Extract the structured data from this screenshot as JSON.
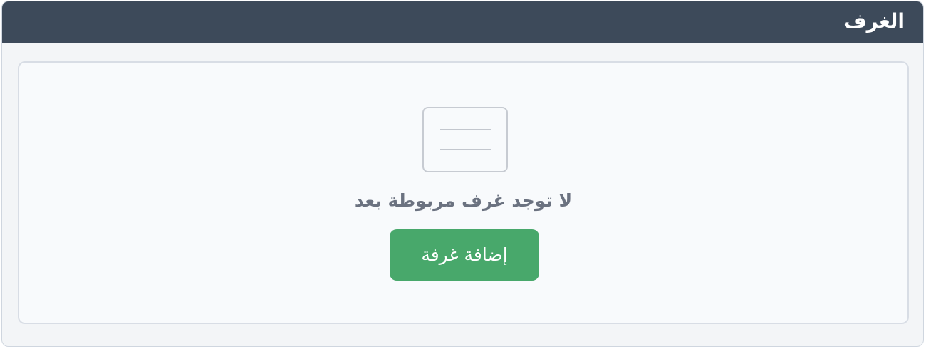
{
  "header": {
    "title": "الغرف"
  },
  "empty_state": {
    "icon": "empty-list-icon",
    "message": "لا توجد غرف مربوطة بعد",
    "add_button_label": "إضافة غرفة"
  },
  "colors": {
    "header_bg": "#3d4a5a",
    "button_bg": "#48a86b",
    "message_text": "#6b7280"
  }
}
